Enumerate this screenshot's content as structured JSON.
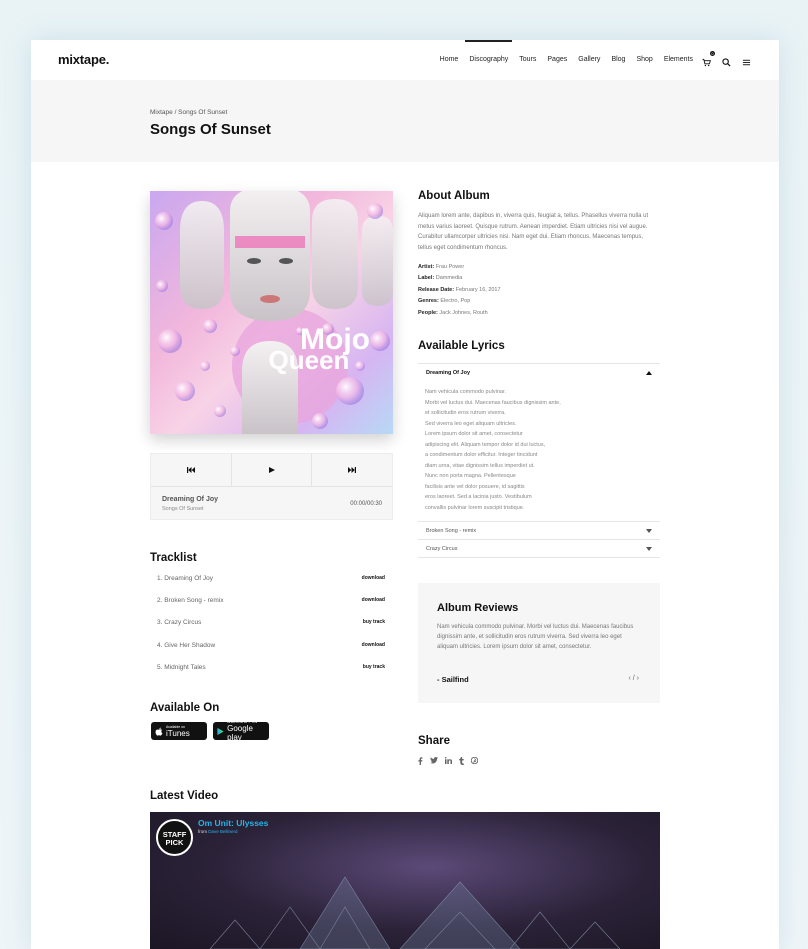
{
  "header": {
    "logo": "mixtape.",
    "nav": [
      "Home",
      "Discography",
      "Tours",
      "Pages",
      "Gallery",
      "Blog",
      "Shop",
      "Elements"
    ],
    "active_nav": "Discography",
    "cart_count": "0"
  },
  "breadcrumb": "Mixtape / Songs Of Sunset",
  "page_title": "Songs Of Sunset",
  "album": {
    "cover_text_line1": "Mojo",
    "cover_text_line2": "Queen"
  },
  "player": {
    "prev_icon": "prev-track-icon",
    "play_icon": "play-icon",
    "next_icon": "next-track-icon",
    "title": "Dreaming Of Joy",
    "subtitle": "Songs Of Sunset",
    "time": "00:00/00:30"
  },
  "tracklist": {
    "heading": "Tracklist",
    "items": [
      {
        "label": "1. Dreaming Of Joy",
        "action": "download"
      },
      {
        "label": "2. Broken Song - remix",
        "action": "download"
      },
      {
        "label": "3. Crazy Circus",
        "action": "buy track"
      },
      {
        "label": "4. Give Her Shadow",
        "action": "download"
      },
      {
        "label": "5. Midnight Tales",
        "action": "buy track"
      }
    ]
  },
  "available_on": {
    "heading": "Available On",
    "itunes_small": "Available on",
    "itunes_big": "iTunes",
    "gplay_small": "ANDROID APP ON",
    "gplay_big": "Google play"
  },
  "about": {
    "heading": "About Album",
    "text": "Aliquam lorem ante, dapibus in, viverra quis, feugiat a, tellus. Phasellus viverra nulla ut metus varius laoreet. Quisque rutrum. Aenean imperdiet. Etiam ultricies nisi vel augue. Curabitur ullamcorper ultricies nisi. Nam eget dui. Etiam rhoncus. Maecenas tempus, tellus eget condimentum rhoncus.",
    "meta": [
      {
        "key": "Artist:",
        "value": "Frau Power"
      },
      {
        "key": "Label:",
        "value": "Dammedia"
      },
      {
        "key": "Release Date:",
        "value": "February 16, 2017"
      },
      {
        "key": "Genres:",
        "value": "Electro, Pop"
      },
      {
        "key": "People:",
        "value": "Jack Johnes, Routh"
      }
    ]
  },
  "lyrics": {
    "heading": "Available Lyrics",
    "open_title": "Dreaming Of Joy",
    "lines": [
      "Nam vehicula commodo pulvinar.",
      "Morbi vel luctus dui. Maecenas faucibus dignissim ante,",
      "et sollicitudin eros rutrum viverra.",
      "Sed viverra leo eget aliquam ultricies.",
      "Lorem ipsum dolor sit amet, consectetur",
      "adipiscing elit. Aliquam tempor dolor id dui luctus,",
      "a condimentum dolor efficitur. Integer tincidunt",
      "diam urna, vitae dignissim tellus imperdiet ut.",
      "Nunc non porta magna. Pellentesque",
      "facilisis ante vel dolor posuere, id sagittis",
      "eros laoreet. Sed a lacinia justo. Vestibulum",
      "convallis pulvinar lorem suscipit tristique."
    ],
    "closed": [
      "Broken Song - remix",
      "Crazy Circus"
    ]
  },
  "reviews": {
    "heading": "Album Reviews",
    "text": "Nam vehicula commodo pulvinar. Morbi vel luctus dui. Maecenas faucibus dignissim ante, et sollicitudin eros rutrum viverra. Sed viverra leo eget aliquam ultricies. Lorem ipsum dolor sit amet, consectetur.",
    "author": "- Sailfind",
    "nav": "‹ / ›"
  },
  "share": {
    "heading": "Share",
    "icons": [
      "facebook-icon",
      "twitter-icon",
      "linkedin-icon",
      "tumblr-icon",
      "pinterest-icon"
    ]
  },
  "video": {
    "heading": "Latest Video",
    "badge_line1": "STAFF",
    "badge_line2": "PICK",
    "title": "Om Unit: Ulysses",
    "from_prefix": "from",
    "from_author": "Dave Bellinerd"
  },
  "colors": {
    "accent": "#27b4e6",
    "band": "#f6f6f6",
    "ink": "#111111"
  }
}
